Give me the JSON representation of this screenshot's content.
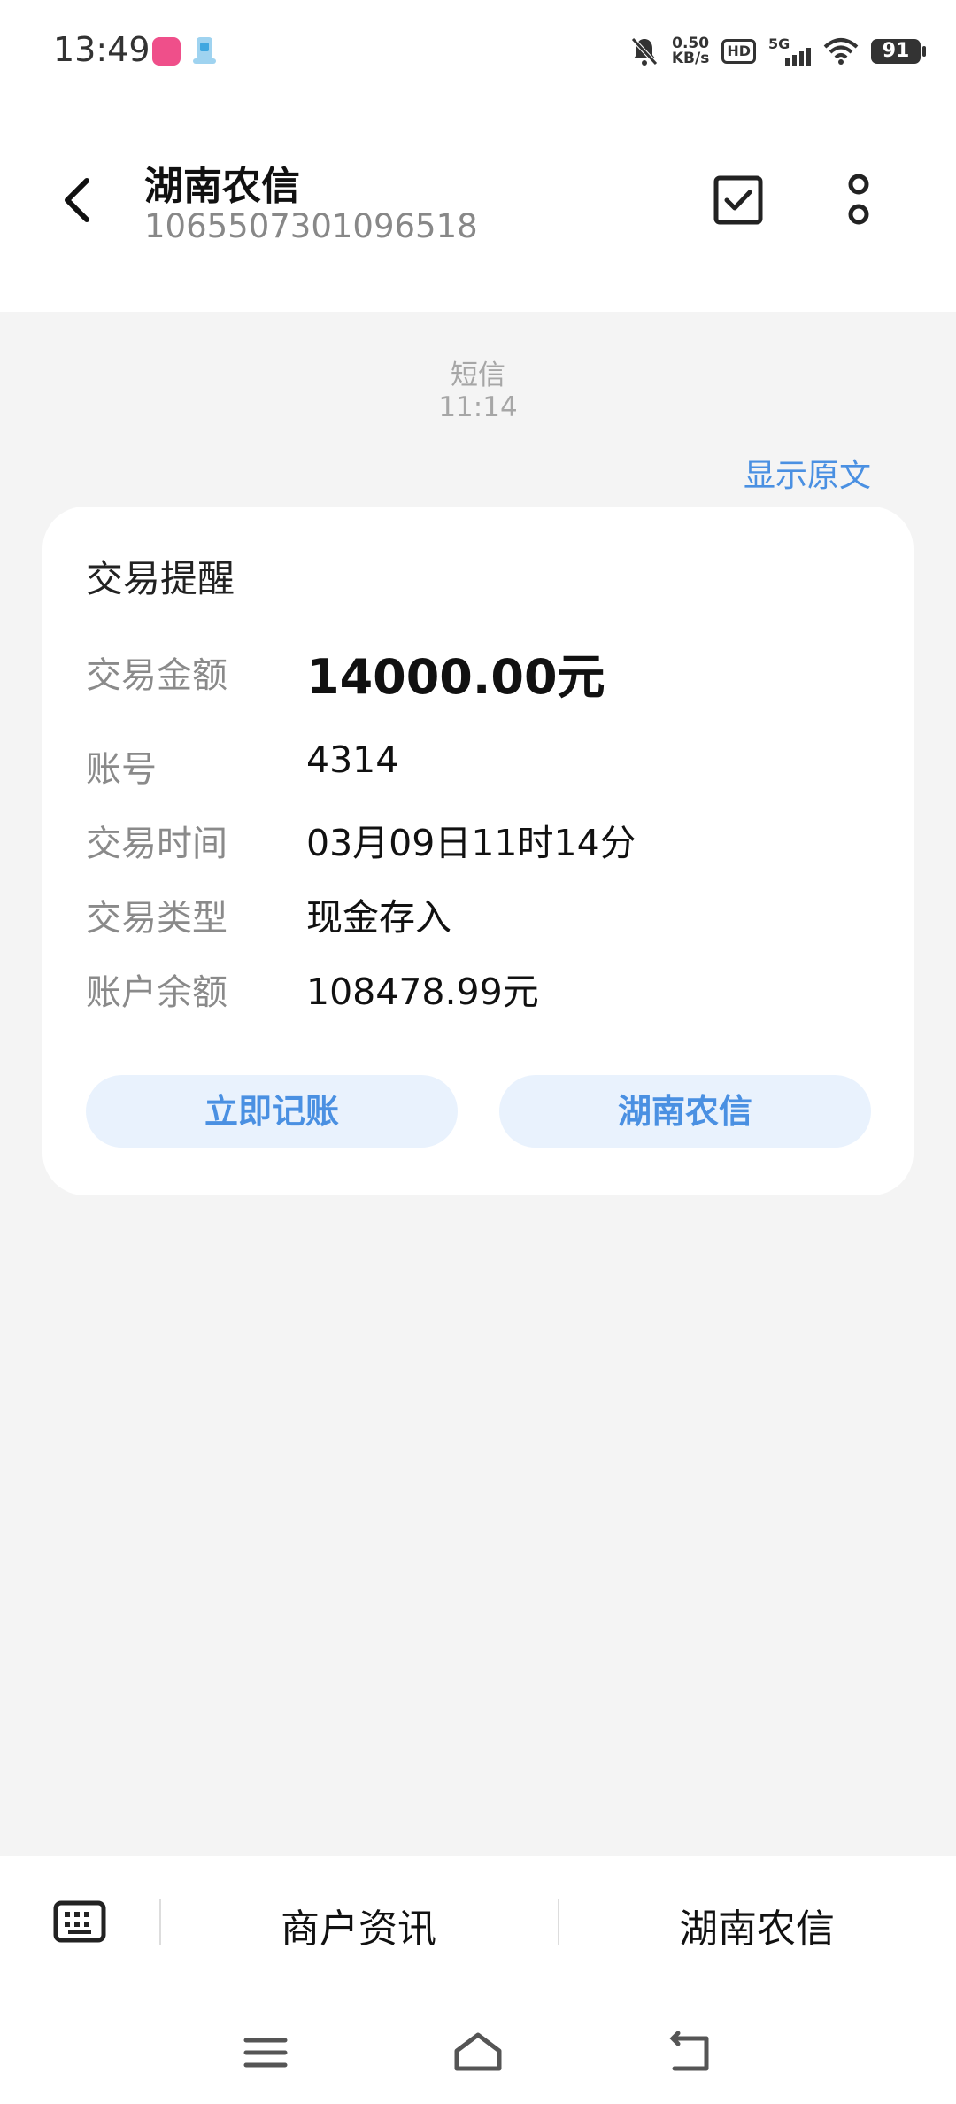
{
  "status_bar": {
    "time": "13:49",
    "net_speed_value": "0.50",
    "net_speed_unit": "KB/s",
    "hd_badge": "HD",
    "network": "5G",
    "battery": "91"
  },
  "header": {
    "title": "湖南农信",
    "subtitle": "1065507301096518"
  },
  "message_meta": {
    "type": "短信",
    "time": "11:14"
  },
  "show_original": "显示原文",
  "card": {
    "title": "交易提醒",
    "rows": [
      {
        "label": "交易金额",
        "value": "14000.00元"
      },
      {
        "label": "账号",
        "value": "4314"
      },
      {
        "label": "交易时间",
        "value": "03月09日11时14分"
      },
      {
        "label": "交易类型",
        "value": "现金存入"
      },
      {
        "label": "账户余额",
        "value": "108478.99元"
      }
    ],
    "buttons": [
      "立即记账",
      "湖南农信"
    ]
  },
  "bottom_menu": [
    "商户资讯",
    "湖南农信"
  ],
  "colors": {
    "accent": "#4a90e2",
    "button_bg": "#e9f2fd",
    "page_bg": "#f4f4f4"
  }
}
